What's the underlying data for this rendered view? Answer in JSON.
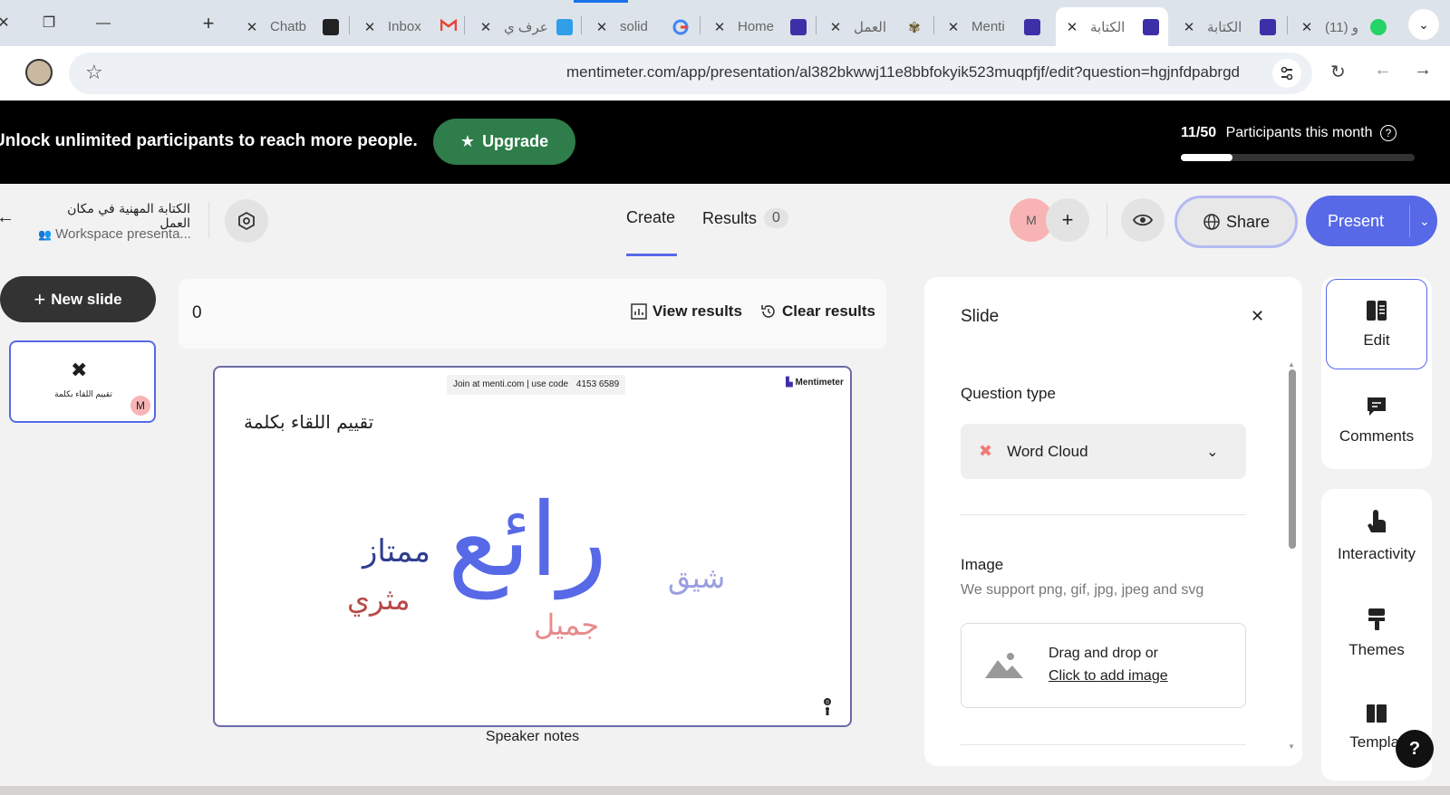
{
  "browser": {
    "tabs": [
      {
        "title": "Chatb",
        "favicon": "chatgpt-icon",
        "color": "#222222"
      },
      {
        "title": "Inbox",
        "favicon": "gmail-icon",
        "color": "#ea4335"
      },
      {
        "title": "عرف ي",
        "favicon": "grid-icon",
        "color": "#2f9fe8"
      },
      {
        "title": "solid",
        "favicon": "google-icon",
        "color": "#4285f4"
      },
      {
        "title": "Home",
        "favicon": "mentimeter-icon",
        "color": "#3d2fa8"
      },
      {
        "title": "العمل",
        "favicon": "star-icon",
        "color": "#6a5a2a"
      },
      {
        "title": "Menti",
        "favicon": "mentimeter-icon",
        "color": "#3d2fa8"
      },
      {
        "title": "الكتابة",
        "favicon": "mentimeter-icon",
        "color": "#3d2fa8"
      },
      {
        "title": "الكتابة",
        "favicon": "mentimeter-icon",
        "color": "#3d2fa8"
      },
      {
        "title": "(11) و",
        "favicon": "whatsapp-icon",
        "color": "#25d366"
      }
    ],
    "url": "mentimeter.com/app/presentation/al382bkwwj11e8bbfokyik523muqpfjf/edit?question=hgjnfdpabrgd"
  },
  "banner": {
    "message": "Unlock unlimited participants to reach more people.",
    "upgrade_label": "Upgrade",
    "participants_count": "11/50",
    "participants_label": "Participants this month",
    "participants_fraction": 0.22
  },
  "header": {
    "presentation_title": "الكتابة المهنية في مكان العمل",
    "workspace_label": "Workspace presenta...",
    "tabs": {
      "create": "Create",
      "results": "Results",
      "results_count": "0"
    },
    "avatar_initial": "M",
    "share_label": "Share",
    "present_label": "Present"
  },
  "left": {
    "new_slide_label": "New slide",
    "thumbnail": {
      "title": "تقييم اللقاء بكلمة",
      "avatar": "M"
    }
  },
  "results_bar": {
    "count": "0",
    "view_results": "View results",
    "clear_results": "Clear results"
  },
  "slide": {
    "join_text": "Join at menti.com | use code",
    "join_code": "4153 6589",
    "brand": "Mentimeter",
    "question": "تقييم اللقاء بكلمة",
    "words": [
      {
        "text": "رائع",
        "color": "#5769e7"
      },
      {
        "text": "ممتاز",
        "color": "#2f3e8f"
      },
      {
        "text": "مثري",
        "color": "#b84a4a"
      },
      {
        "text": "جميل",
        "color": "#e88a8a"
      },
      {
        "text": "شيق",
        "color": "#9a9ee0"
      }
    ],
    "speaker_notes": "Speaker notes"
  },
  "panel": {
    "title": "Slide",
    "question_type_label": "Question type",
    "question_type_value": "Word Cloud",
    "image_label": "Image",
    "image_hint": "We support png, gif, jpg, jpeg and svg",
    "drop_text": "Drag and drop or",
    "drop_link": "Click to add image"
  },
  "rail": {
    "edit": "Edit",
    "comments": "Comments",
    "interactivity": "Interactivity",
    "themes": "Themes",
    "templates": "Templat",
    "help": "?"
  },
  "colors": {
    "accent": "#5769e7",
    "upgrade": "#2e7d4a"
  }
}
